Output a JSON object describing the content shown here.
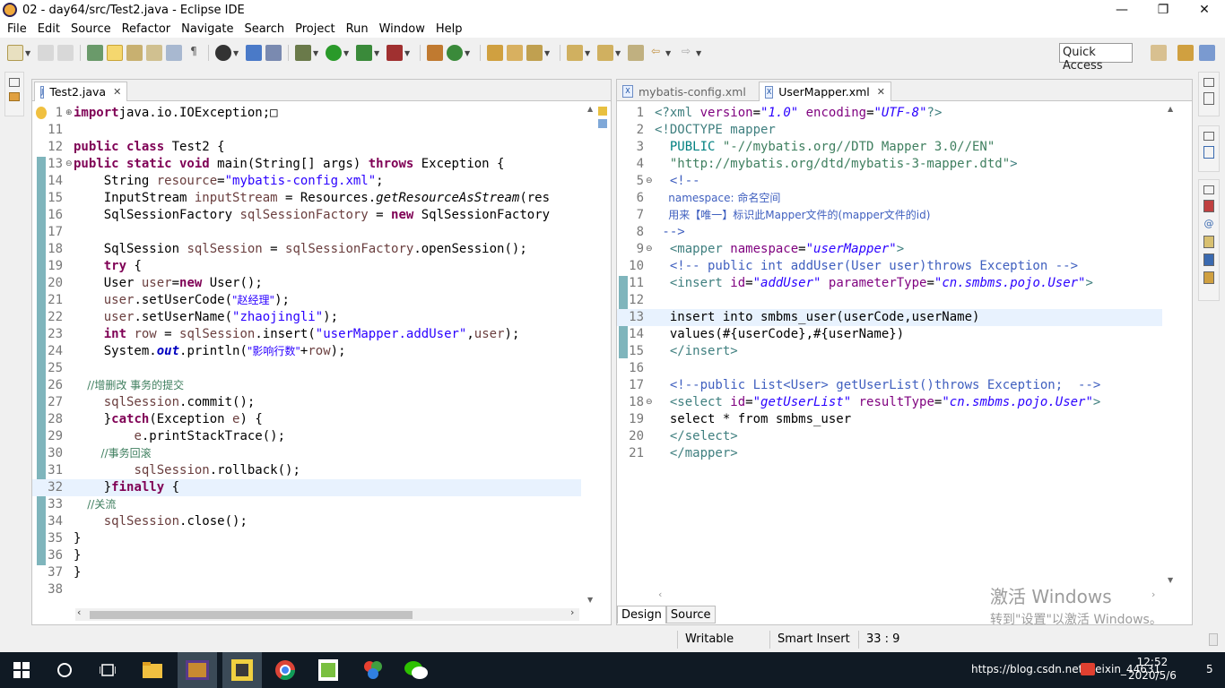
{
  "window": {
    "title": "02 - day64/src/Test2.java - Eclipse IDE",
    "minimize": "—",
    "maximize": "❐",
    "close": "✕"
  },
  "menu": [
    "File",
    "Edit",
    "Source",
    "Refactor",
    "Navigate",
    "Search",
    "Project",
    "Run",
    "Window",
    "Help"
  ],
  "quick_access": "Quick Access",
  "left_editor": {
    "tab": "Test2.java",
    "file_icon": "J",
    "lines": [
      {
        "n": "1",
        "segs": [
          [
            "kw",
            "import"
          ],
          [
            "",
            "java.io.IOException;"
          ],
          [
            "",
            "□"
          ]
        ]
      },
      {
        "n": "11",
        "segs": []
      },
      {
        "n": "12",
        "segs": [
          [
            "kw",
            "public class"
          ],
          [
            "",
            " Test2 {"
          ]
        ]
      },
      {
        "n": "13",
        "segs": [
          [
            "kw",
            "public static void"
          ],
          [
            "",
            " main(String[] args) "
          ],
          [
            "kw",
            "throws"
          ],
          [
            "",
            " Exception {"
          ]
        ]
      },
      {
        "n": "14",
        "segs": [
          [
            "",
            "    String "
          ],
          [
            "var",
            "resource"
          ],
          [
            "",
            "="
          ],
          [
            "str",
            "\"mybatis-config.xml\""
          ],
          [
            "",
            ";"
          ]
        ]
      },
      {
        "n": "15",
        "segs": [
          [
            "",
            "    InputStream "
          ],
          [
            "var",
            "inputStream"
          ],
          [
            "",
            " = Resources."
          ],
          [
            "ital",
            "getResourceAsStream"
          ],
          [
            "",
            "(res"
          ]
        ]
      },
      {
        "n": "16",
        "segs": [
          [
            "",
            "    SqlSessionFactory "
          ],
          [
            "var",
            "sqlSessionFactory"
          ],
          [
            "",
            " = "
          ],
          [
            "kw",
            "new"
          ],
          [
            "",
            " SqlSessionFactory"
          ]
        ]
      },
      {
        "n": "17",
        "segs": []
      },
      {
        "n": "18",
        "segs": [
          [
            "",
            "    SqlSession "
          ],
          [
            "var",
            "sqlSession"
          ],
          [
            "",
            " = "
          ],
          [
            "var",
            "sqlSessionFactory"
          ],
          [
            "",
            ".openSession();"
          ]
        ]
      },
      {
        "n": "19",
        "segs": [
          [
            "",
            "    "
          ],
          [
            "kw",
            "try"
          ],
          [
            "",
            " {"
          ]
        ]
      },
      {
        "n": "20",
        "segs": [
          [
            "",
            "    User "
          ],
          [
            "var",
            "user"
          ],
          [
            "",
            "="
          ],
          [
            "kw",
            "new"
          ],
          [
            "",
            " User();"
          ]
        ]
      },
      {
        "n": "21",
        "segs": [
          [
            "",
            "    "
          ],
          [
            "var",
            "user"
          ],
          [
            "",
            ".setUserCode("
          ],
          [
            "str",
            "\"赵经理\""
          ],
          [
            "",
            ");"
          ]
        ]
      },
      {
        "n": "22",
        "segs": [
          [
            "",
            "    "
          ],
          [
            "var",
            "user"
          ],
          [
            "",
            ".setUserName("
          ],
          [
            "str",
            "\"zhaojingli\""
          ],
          [
            "",
            ");"
          ]
        ]
      },
      {
        "n": "23",
        "segs": [
          [
            "",
            "    "
          ],
          [
            "kw",
            "int"
          ],
          [
            "",
            " "
          ],
          [
            "var",
            "row"
          ],
          [
            "",
            " = "
          ],
          [
            "var",
            "sqlSession"
          ],
          [
            "",
            ".insert("
          ],
          [
            "str",
            "\"userMapper.addUser\""
          ],
          [
            "",
            ","
          ],
          [
            "var",
            "user"
          ],
          [
            "",
            ");"
          ]
        ]
      },
      {
        "n": "24",
        "segs": [
          [
            "",
            "    System."
          ],
          [
            "field",
            "out"
          ],
          [
            "",
            ".println("
          ],
          [
            "str",
            "\"影响行数\""
          ],
          [
            "",
            "+"
          ],
          [
            "var",
            "row"
          ],
          [
            "",
            ");"
          ]
        ]
      },
      {
        "n": "25",
        "segs": []
      },
      {
        "n": "26",
        "segs": [
          [
            "cmt",
            "    //增删改 事务的提交"
          ]
        ]
      },
      {
        "n": "27",
        "segs": [
          [
            "",
            "    "
          ],
          [
            "var",
            "sqlSession"
          ],
          [
            "",
            ".commit();"
          ]
        ]
      },
      {
        "n": "28",
        "segs": [
          [
            "",
            "    }"
          ],
          [
            "kw",
            "catch"
          ],
          [
            "",
            "(Exception "
          ],
          [
            "var",
            "e"
          ],
          [
            "",
            ") {"
          ]
        ]
      },
      {
        "n": "29",
        "segs": [
          [
            "",
            "        "
          ],
          [
            "var",
            "e"
          ],
          [
            "",
            ".printStackTrace();"
          ]
        ]
      },
      {
        "n": "30",
        "segs": [
          [
            "cmt",
            "        //事务回滚"
          ]
        ]
      },
      {
        "n": "31",
        "segs": [
          [
            "",
            "        "
          ],
          [
            "var",
            "sqlSession"
          ],
          [
            "",
            ".rollback();"
          ]
        ]
      },
      {
        "n": "32",
        "segs": [
          [
            "",
            "    }"
          ],
          [
            "kw",
            "finally"
          ],
          [
            "",
            " {"
          ]
        ]
      },
      {
        "n": "33",
        "segs": [
          [
            "cmt",
            "    //关流"
          ]
        ]
      },
      {
        "n": "34",
        "segs": [
          [
            "",
            "    "
          ],
          [
            "var",
            "sqlSession"
          ],
          [
            "",
            ".close();"
          ]
        ]
      },
      {
        "n": "35",
        "segs": [
          [
            "",
            "}"
          ]
        ]
      },
      {
        "n": "36",
        "segs": [
          [
            "",
            "}"
          ]
        ]
      },
      {
        "n": "37",
        "segs": [
          [
            "",
            "}"
          ]
        ]
      },
      {
        "n": "38",
        "segs": []
      }
    ]
  },
  "right_editor": {
    "tabs": [
      "mybatis-config.xml",
      "UserMapper.xml"
    ],
    "file_icon": "X",
    "lines": [
      {
        "n": "1",
        "segs": [
          [
            "x-tag",
            "<?xml "
          ],
          [
            "x-attr",
            "version"
          ],
          [
            "",
            "="
          ],
          [
            "x-val",
            "\"1.0\""
          ],
          [
            "",
            " "
          ],
          [
            "x-attr",
            "encoding"
          ],
          [
            "",
            "="
          ],
          [
            "x-val",
            "\"UTF-8\""
          ],
          [
            "x-tag",
            "?>"
          ]
        ]
      },
      {
        "n": "2",
        "segs": [
          [
            "x-tag",
            "<!DOCTYPE mapper"
          ]
        ]
      },
      {
        "n": "3",
        "segs": [
          [
            "x-doc",
            "  PUBLIC "
          ],
          [
            "x-dstr",
            "\"-//mybatis.org//DTD Mapper 3.0//EN\""
          ]
        ]
      },
      {
        "n": "4",
        "segs": [
          [
            "x-dstr",
            "  \"http://mybatis.org/dtd/mybatis-3-mapper.dtd\""
          ],
          [
            "x-tag",
            ">"
          ]
        ]
      },
      {
        "n": "5",
        "segs": [
          [
            "x-cmt",
            "  <!--"
          ]
        ]
      },
      {
        "n": "6",
        "segs": [
          [
            "x-cmt",
            "    namespace: 命名空间"
          ]
        ]
      },
      {
        "n": "7",
        "segs": [
          [
            "x-cmt",
            "    用来【唯一】标识此Mapper文件的(mapper文件的id)"
          ]
        ]
      },
      {
        "n": "8",
        "segs": [
          [
            "x-cmt",
            " -->"
          ]
        ]
      },
      {
        "n": "9",
        "segs": [
          [
            "x-tag",
            "  <mapper "
          ],
          [
            "x-attr",
            "namespace"
          ],
          [
            "",
            "="
          ],
          [
            "x-val",
            "\"userMapper\""
          ],
          [
            "x-tag",
            ">"
          ]
        ]
      },
      {
        "n": "10",
        "segs": [
          [
            "x-cmt",
            "  <!-- public int addUser(User user)throws Exception -->"
          ]
        ]
      },
      {
        "n": "11",
        "segs": [
          [
            "x-tag",
            "  <insert "
          ],
          [
            "x-attr",
            "id"
          ],
          [
            "",
            "="
          ],
          [
            "x-val",
            "\"addUser\""
          ],
          [
            "",
            " "
          ],
          [
            "x-attr",
            "parameterType"
          ],
          [
            "",
            "="
          ],
          [
            "x-val",
            "\"cn.smbms.pojo.User\""
          ],
          [
            "x-tag",
            ">"
          ]
        ]
      },
      {
        "n": "12",
        "segs": []
      },
      {
        "n": "13",
        "segs": [
          [
            "",
            "  insert into smbms_user(userCode,userName)"
          ]
        ]
      },
      {
        "n": "14",
        "segs": [
          [
            "",
            "  values(#{userCode},#{userName})"
          ]
        ]
      },
      {
        "n": "15",
        "segs": [
          [
            "x-tag",
            "  </insert>"
          ]
        ]
      },
      {
        "n": "16",
        "segs": []
      },
      {
        "n": "17",
        "segs": [
          [
            "x-cmt",
            "  <!--public List<User> getUserList()throws Exception;  -->"
          ]
        ]
      },
      {
        "n": "18",
        "segs": [
          [
            "x-tag",
            "  <select "
          ],
          [
            "x-attr",
            "id"
          ],
          [
            "",
            "="
          ],
          [
            "x-val",
            "\"getUserList\""
          ],
          [
            "",
            " "
          ],
          [
            "x-attr",
            "resultType"
          ],
          [
            "",
            "="
          ],
          [
            "x-val",
            "\"cn.smbms.pojo.User\""
          ],
          [
            "x-tag",
            ">"
          ]
        ]
      },
      {
        "n": "19",
        "segs": [
          [
            "",
            "  select * from smbms_user"
          ]
        ]
      },
      {
        "n": "20",
        "segs": [
          [
            "x-tag",
            "  </select>"
          ]
        ]
      },
      {
        "n": "21",
        "segs": [
          [
            "x-tag",
            "  </mapper>"
          ]
        ]
      }
    ],
    "bottom_tabs": [
      "Design",
      "Source"
    ]
  },
  "status": {
    "mode": "Writable",
    "insert": "Smart Insert",
    "position": "33 : 9"
  },
  "watermark": {
    "line1": "激活 Windows",
    "line2": "转到\"设置\"以激活 Windows。"
  },
  "taskbar": {
    "tray_text": "https://blog.csdn.net/weixin_44631",
    "tray_num": "5",
    "time": "12:52",
    "date": "2020/5/6"
  },
  "colors": {
    "keyword": "#7f0055",
    "string": "#2a00ff",
    "comment": "#3f7f5f",
    "xml_tag": "#3f7f7f",
    "xml_attr": "#7f007f",
    "change_bar": "#7fb5bc",
    "taskbar_bg": "#101a24"
  }
}
